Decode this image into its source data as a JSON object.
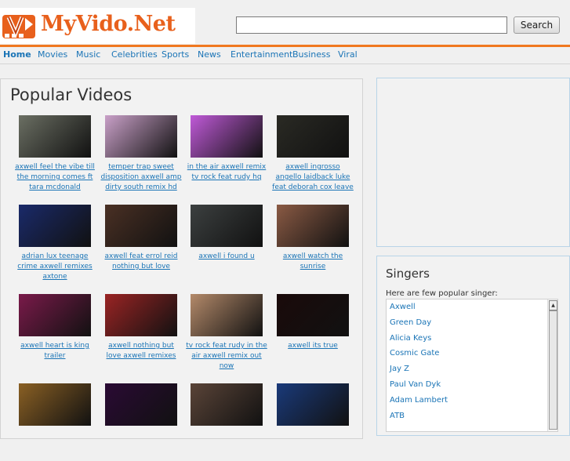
{
  "header": {
    "logo_text": "MyVido.Net",
    "search_placeholder": "",
    "search_button": "Search"
  },
  "nav": [
    {
      "label": "Home",
      "active": true
    },
    {
      "label": "Movies"
    },
    {
      "label": "Music"
    },
    {
      "label": "Celebrities"
    },
    {
      "label": "Sports"
    },
    {
      "label": "News"
    },
    {
      "label": "Entertainment"
    },
    {
      "label": "Business"
    },
    {
      "label": "Viral"
    }
  ],
  "main": {
    "title": "Popular Videos",
    "videos": [
      {
        "title": "axwell feel the vibe till the morning comes ft tara mcdonald",
        "thumb": "#6b6f63"
      },
      {
        "title": "temper trap sweet disposition axwell amp dirty south remix hd",
        "thumb": "#c9a0c8"
      },
      {
        "title": "in the air axwell remix tv rock feat rudy hq",
        "thumb": "#c05ad8"
      },
      {
        "title": "axwell ingrosso angello laidback luke feat deborah cox leave the world",
        "thumb": "#2a2a24"
      },
      {
        "title": "adrian lux teenage crime axwell remixes axtone",
        "thumb": "#1a2a6a"
      },
      {
        "title": "axwell feat errol reid nothing but love",
        "thumb": "#4a3024"
      },
      {
        "title": "axwell i found u",
        "thumb": "#3c4040"
      },
      {
        "title": "axwell watch the sunrise",
        "thumb": "#8a5a44"
      },
      {
        "title": "axwell heart is king trailer",
        "thumb": "#7a1a4a"
      },
      {
        "title": "axwell nothing but love axwell remixes",
        "thumb": "#9a2424"
      },
      {
        "title": "tv rock feat rudy in the air axwell remix out now",
        "thumb": "#b48a6a"
      },
      {
        "title": "axwell its true",
        "thumb": "#1a0a0a"
      },
      {
        "title": "",
        "thumb": "#8a6024"
      },
      {
        "title": "",
        "thumb": "#2a0a34"
      },
      {
        "title": "",
        "thumb": "#5a4438"
      },
      {
        "title": "",
        "thumb": "#1a3a7a"
      }
    ]
  },
  "singers": {
    "title": "Singers",
    "intro": "Here are few popular singer:",
    "items": [
      "Axwell",
      "Green Day",
      "Alicia Keys",
      "Cosmic Gate",
      "Jay Z",
      "Paul Van Dyk",
      "Adam Lambert",
      "ATB"
    ]
  }
}
